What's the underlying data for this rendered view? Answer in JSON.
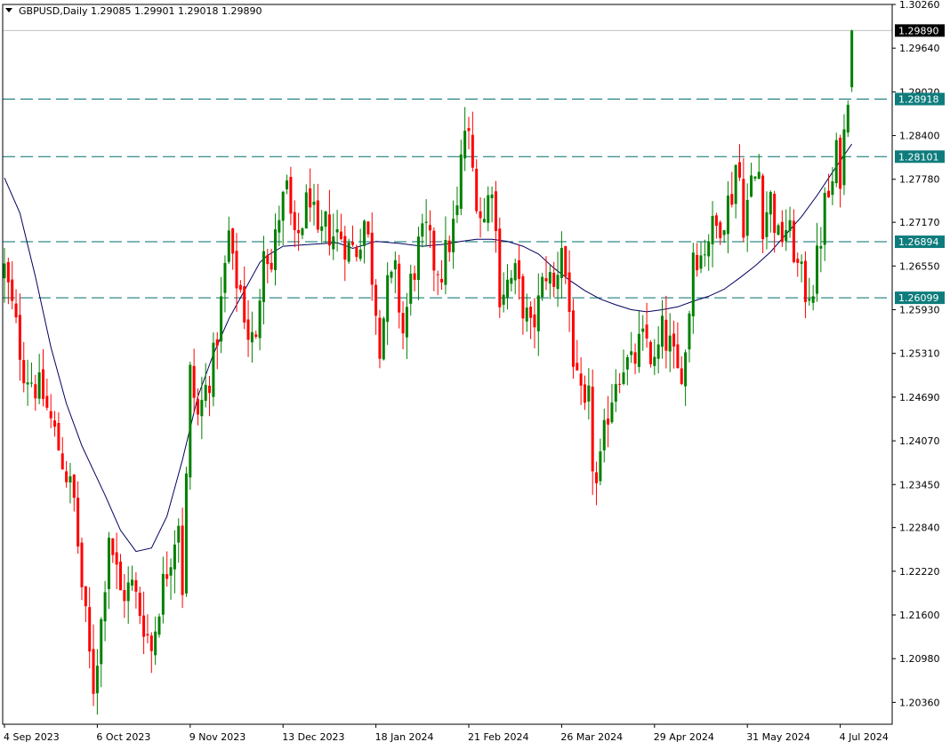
{
  "header": {
    "symbol": "GBPUSD,Daily",
    "ohlc": "1.29085 1.29901 1.29018 1.29890"
  },
  "colors": {
    "bull": "#008000",
    "bear": "#ff0000",
    "ma": "#000060",
    "level": "#006e6e",
    "level_label_bg": "#0e7c7c",
    "current_label_bg": "#000000",
    "grid_frame": "#000000"
  },
  "chart_data": {
    "type": "candlestick",
    "title": "GBPUSD,Daily",
    "ylim": [
      1.2005,
      1.3026
    ],
    "y_ticks": [
      "1.30260",
      "1.29640",
      "1.29020",
      "1.28400",
      "1.27780",
      "1.27170",
      "1.26550",
      "1.25930",
      "1.25310",
      "1.24690",
      "1.24070",
      "1.23450",
      "1.22840",
      "1.22220",
      "1.21600",
      "1.20980",
      "1.20360"
    ],
    "x_ticks": [
      "4 Sep 2023",
      "6 Oct 2023",
      "9 Nov 2023",
      "13 Dec 2023",
      "18 Jan 2024",
      "21 Feb 2024",
      "26 Mar 2024",
      "29 Apr 2024",
      "31 May 2024",
      "4 Jul 2024"
    ],
    "x_tick_bar_index": [
      0,
      24,
      48,
      72,
      96,
      120,
      144,
      168,
      192,
      216
    ],
    "current_price": "1.29890",
    "horizontal_levels": [
      "1.28918",
      "1.28101",
      "1.26894",
      "1.26099"
    ],
    "bars_visible": 223,
    "close_points": [
      [
        0,
        1.265
      ],
      [
        5,
        1.251
      ],
      [
        10,
        1.247
      ],
      [
        15,
        1.238
      ],
      [
        18,
        1.232
      ],
      [
        20,
        1.22
      ],
      [
        22,
        1.21
      ],
      [
        23,
        1.206
      ],
      [
        25,
        1.215
      ],
      [
        27,
        1.228
      ],
      [
        30,
        1.219
      ],
      [
        33,
        1.22
      ],
      [
        36,
        1.215
      ],
      [
        38,
        1.211
      ],
      [
        40,
        1.218
      ],
      [
        43,
        1.225
      ],
      [
        45,
        1.23
      ],
      [
        46,
        1.22
      ],
      [
        48,
        1.25
      ],
      [
        50,
        1.244
      ],
      [
        52,
        1.248
      ],
      [
        54,
        1.252
      ],
      [
        56,
        1.26
      ],
      [
        58,
        1.27
      ],
      [
        59,
        1.265
      ],
      [
        61,
        1.262
      ],
      [
        63,
        1.256
      ],
      [
        65,
        1.254
      ],
      [
        67,
        1.27
      ],
      [
        69,
        1.265
      ],
      [
        71,
        1.273
      ],
      [
        73,
        1.276
      ],
      [
        75,
        1.268
      ],
      [
        77,
        1.272
      ],
      [
        79,
        1.276
      ],
      [
        81,
        1.268
      ],
      [
        83,
        1.271
      ],
      [
        85,
        1.27
      ],
      [
        87,
        1.27
      ],
      [
        89,
        1.268
      ],
      [
        91,
        1.268
      ],
      [
        93,
        1.272
      ],
      [
        94,
        1.269
      ],
      [
        96,
        1.26
      ],
      [
        97,
        1.255
      ],
      [
        99,
        1.262
      ],
      [
        101,
        1.264
      ],
      [
        103,
        1.256
      ],
      [
        105,
        1.263
      ],
      [
        107,
        1.268
      ],
      [
        109,
        1.27
      ],
      [
        111,
        1.266
      ],
      [
        113,
        1.265
      ],
      [
        115,
        1.269
      ],
      [
        117,
        1.273
      ],
      [
        118,
        1.28
      ],
      [
        119,
        1.285
      ],
      [
        120,
        1.283
      ],
      [
        121,
        1.279
      ],
      [
        122,
        1.276
      ],
      [
        123,
        1.273
      ],
      [
        124,
        1.272
      ],
      [
        126,
        1.278
      ],
      [
        127,
        1.27
      ],
      [
        128,
        1.262
      ],
      [
        130,
        1.263
      ],
      [
        132,
        1.264
      ],
      [
        134,
        1.26
      ],
      [
        136,
        1.256
      ],
      [
        138,
        1.26
      ],
      [
        140,
        1.265
      ],
      [
        142,
        1.262
      ],
      [
        144,
        1.269
      ],
      [
        146,
        1.259
      ],
      [
        147,
        1.253
      ],
      [
        148,
        1.248
      ],
      [
        150,
        1.244
      ],
      [
        151,
        1.246
      ],
      [
        152,
        1.238
      ],
      [
        153,
        1.234
      ],
      [
        154,
        1.237
      ],
      [
        156,
        1.245
      ],
      [
        158,
        1.25
      ],
      [
        160,
        1.252
      ],
      [
        162,
        1.251
      ],
      [
        164,
        1.254
      ],
      [
        166,
        1.255
      ],
      [
        168,
        1.251
      ],
      [
        170,
        1.256
      ],
      [
        172,
        1.254
      ],
      [
        174,
        1.25
      ],
      [
        176,
        1.253
      ],
      [
        177,
        1.26
      ],
      [
        178,
        1.268
      ],
      [
        180,
        1.267
      ],
      [
        182,
        1.27
      ],
      [
        184,
        1.271
      ],
      [
        186,
        1.273
      ],
      [
        188,
        1.276
      ],
      [
        189,
        1.28
      ],
      [
        190,
        1.278
      ],
      [
        191,
        1.272
      ],
      [
        193,
        1.277
      ],
      [
        195,
        1.279
      ],
      [
        196,
        1.272
      ],
      [
        198,
        1.275
      ],
      [
        200,
        1.269
      ],
      [
        202,
        1.271
      ],
      [
        204,
        1.268
      ],
      [
        205,
        1.265
      ],
      [
        207,
        1.262
      ],
      [
        209,
        1.263
      ],
      [
        210,
        1.266
      ],
      [
        211,
        1.27
      ],
      [
        212,
        1.274
      ],
      [
        214,
        1.277
      ],
      [
        215,
        1.281
      ],
      [
        216,
        1.279
      ],
      [
        217,
        1.284
      ],
      [
        218,
        1.291
      ],
      [
        219,
        1.2989
      ]
    ],
    "ma_points": [
      [
        0,
        1.278
      ],
      [
        4,
        1.273
      ],
      [
        8,
        1.264
      ],
      [
        12,
        1.254
      ],
      [
        16,
        1.246
      ],
      [
        20,
        1.24
      ],
      [
        26,
        1.233
      ],
      [
        30,
        1.228
      ],
      [
        34,
        1.225
      ],
      [
        38,
        1.2255
      ],
      [
        42,
        1.23
      ],
      [
        46,
        1.238
      ],
      [
        50,
        1.247
      ],
      [
        54,
        1.253
      ],
      [
        58,
        1.258
      ],
      [
        62,
        1.262
      ],
      [
        66,
        1.266
      ],
      [
        68,
        1.267
      ],
      [
        72,
        1.2683
      ],
      [
        80,
        1.2686
      ],
      [
        86,
        1.2688
      ],
      [
        90,
        1.268
      ],
      [
        96,
        1.269
      ],
      [
        102,
        1.2687
      ],
      [
        108,
        1.2683
      ],
      [
        114,
        1.2686
      ],
      [
        118,
        1.269
      ],
      [
        122,
        1.2693
      ],
      [
        126,
        1.2693
      ],
      [
        130,
        1.269
      ],
      [
        134,
        1.2683
      ],
      [
        138,
        1.2672
      ],
      [
        142,
        1.2652
      ],
      [
        146,
        1.2635
      ],
      [
        150,
        1.262
      ],
      [
        154,
        1.2608
      ],
      [
        158,
        1.26
      ],
      [
        162,
        1.2593
      ],
      [
        166,
        1.259
      ],
      [
        170,
        1.2593
      ],
      [
        174,
        1.2597
      ],
      [
        178,
        1.2605
      ],
      [
        182,
        1.2612
      ],
      [
        186,
        1.2622
      ],
      [
        190,
        1.2638
      ],
      [
        194,
        1.2655
      ],
      [
        198,
        1.2675
      ],
      [
        202,
        1.27
      ],
      [
        206,
        1.2725
      ],
      [
        210,
        1.2755
      ],
      [
        214,
        1.2788
      ],
      [
        216,
        1.2804
      ],
      [
        218,
        1.282
      ],
      [
        219,
        1.2828
      ]
    ]
  }
}
